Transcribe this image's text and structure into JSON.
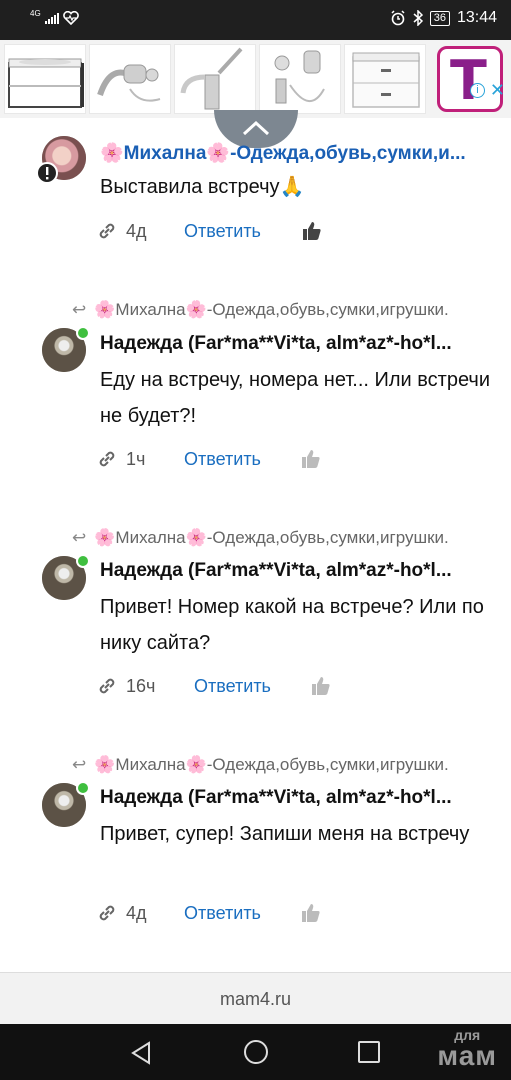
{
  "status_bar": {
    "network": "4G",
    "battery": "36",
    "time": "13:44"
  },
  "ad": {
    "brand_letter": "T",
    "info_label": "i",
    "close_label": "✕"
  },
  "comments": [
    {
      "author": "🌸Михална🌸-Одежда,обувь,сумки,и...",
      "text": "Выставила встречу🙏",
      "time": "4д",
      "reply_label": "Ответить"
    },
    {
      "reply_to": "🌸Михална🌸-Одежда,обувь,сумки,игрушки.",
      "author": "Надежда (Far*ma**Vi*ta, alm*az*-ho*l...",
      "text": "Еду на встречу, номера нет... Или встречи не будет?!",
      "time": "1ч",
      "reply_label": "Ответить"
    },
    {
      "reply_to": "🌸Михална🌸-Одежда,обувь,сумки,игрушки.",
      "author": "Надежда (Far*ma**Vi*ta, alm*az*-ho*l...",
      "text": "Привет! Номер какой на встрече? Или по нику сайта?",
      "time": "16ч",
      "reply_label": "Ответить"
    },
    {
      "reply_to": "🌸Михална🌸-Одежда,обувь,сумки,игрушки.",
      "author": "Надежда (Far*ma**Vi*ta, alm*az*-ho*l...",
      "text": "Привет, супер! Запиши меня на встречу",
      "time": "4д",
      "reply_label": "Ответить"
    }
  ],
  "footer": {
    "site": "mam4.ru"
  },
  "watermark": {
    "line1": "для",
    "line2": "мам"
  },
  "colors": {
    "link_blue": "#1a6ec0",
    "author_blue": "#1a5fb4",
    "online_green": "#3fbf3f"
  }
}
